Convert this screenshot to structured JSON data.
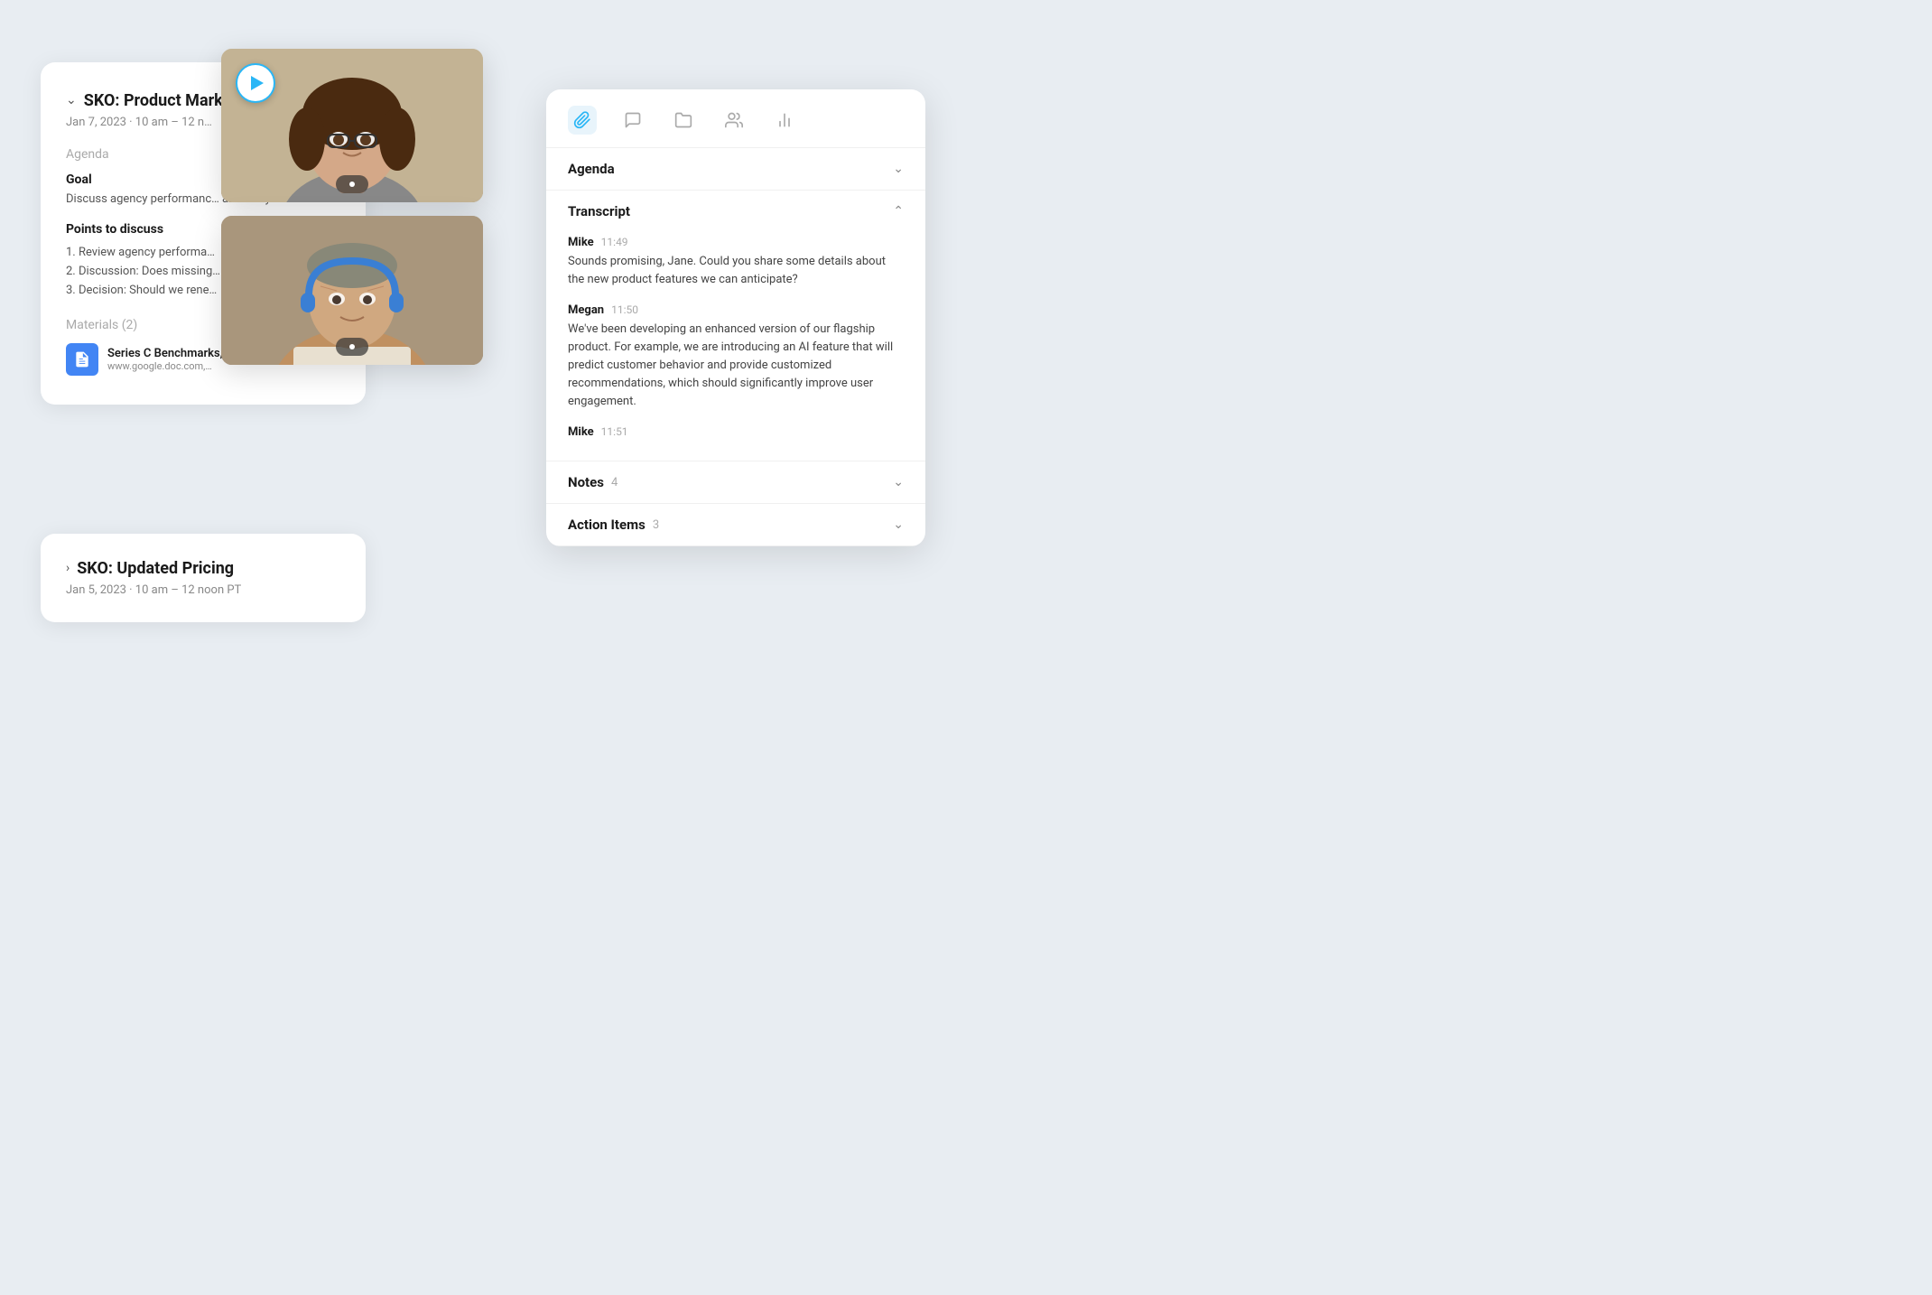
{
  "meeting1": {
    "title": "SKO: Product Marke…",
    "date": "Jan 7, 2023 · 10 am – 12 n…",
    "agenda_label": "Agenda",
    "goal_title": "Goal",
    "goal_text": "Discuss agency performanc… another year.",
    "points_title": "Points to discuss",
    "points": [
      "1. Review agency performa…",
      "2. Discussion: Does missing…",
      "3. Decision: Should we rene…"
    ],
    "materials_label": "Materials (2)",
    "material_title": "Series C Benchmarks,…",
    "material_url": "www.google.doc.com,…"
  },
  "meeting2": {
    "title": "SKO: Updated Pricing",
    "date": "Jan 5, 2023 · 10 am – 12 noon PT"
  },
  "transcript_panel": {
    "tabs": [
      "clip-icon",
      "chat-icon",
      "folder-icon",
      "people-icon",
      "chart-icon"
    ],
    "agenda_section": {
      "title": "Agenda",
      "collapsed": true
    },
    "transcript_section": {
      "title": "Transcript",
      "collapsed": false,
      "messages": [
        {
          "name": "Mike",
          "time": "11:49",
          "text": "Sounds promising, Jane. Could you share some details about the new product features we can anticipate?"
        },
        {
          "name": "Megan",
          "time": "11:50",
          "text": "We've been developing an enhanced version of our flagship product. For example, we are introducing an AI feature that will predict customer behavior and provide customized recommendations, which should significantly improve user engagement."
        },
        {
          "name": "Mike",
          "time": "11:51",
          "text": ""
        }
      ]
    },
    "notes_section": {
      "title": "Notes",
      "count": "4"
    },
    "action_items_section": {
      "title": "Action Items",
      "count": "3"
    }
  }
}
